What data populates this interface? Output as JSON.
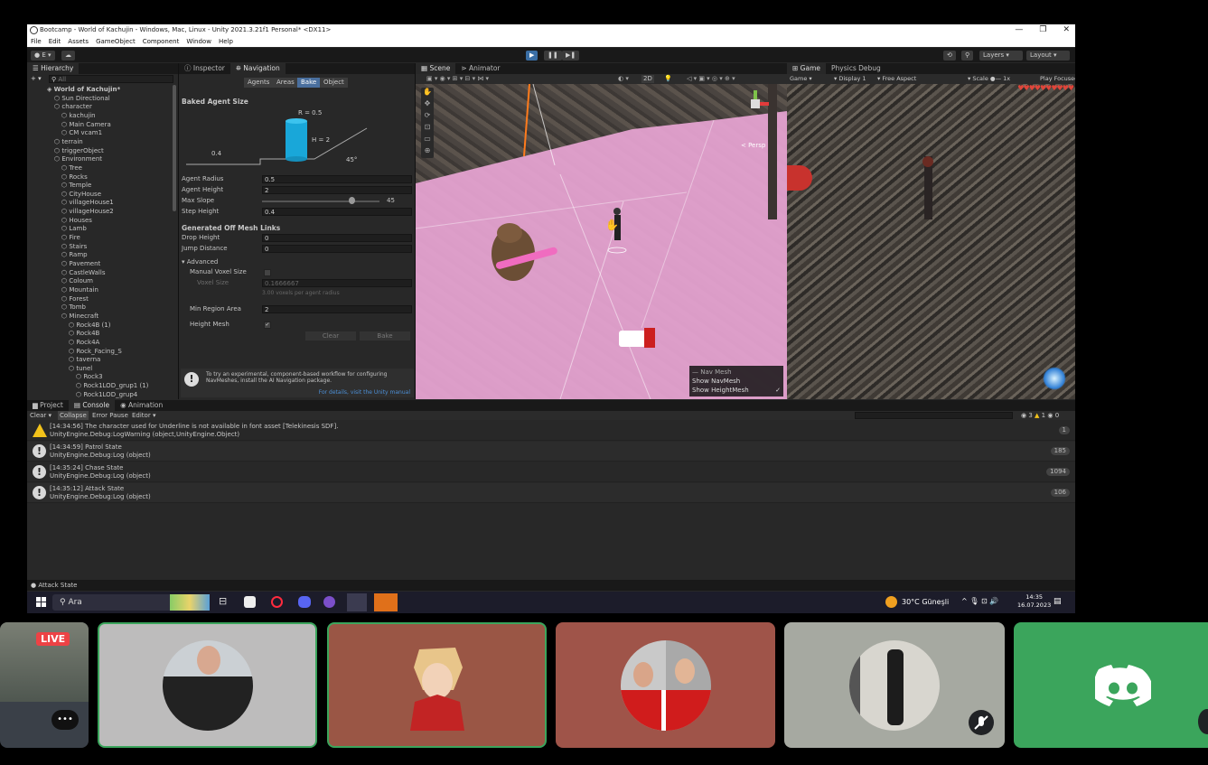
{
  "window": {
    "title": "Bootcamp - World of Kachujin - Windows, Mac, Linux - Unity 2021.3.21f1 Personal* <DX11>",
    "controls": [
      "—",
      "❐",
      "✕"
    ]
  },
  "menu": [
    "File",
    "Edit",
    "Assets",
    "GameObject",
    "Component",
    "Window",
    "Help"
  ],
  "toolbar": {
    "account": "E",
    "layers_label": "Layers",
    "layout_label": "Layout"
  },
  "hierarchy": {
    "tab": "Hierarchy",
    "search_placeholder": "All",
    "items": [
      {
        "label": "World of Kachujin*",
        "depth": 0
      },
      {
        "label": "Sun Directional",
        "depth": 1
      },
      {
        "label": "character",
        "depth": 1
      },
      {
        "label": "kachujin",
        "depth": 2
      },
      {
        "label": "Main Camera",
        "depth": 2
      },
      {
        "label": "CM vcam1",
        "depth": 2
      },
      {
        "label": "terrain",
        "depth": 1
      },
      {
        "label": "triggerObject",
        "depth": 1
      },
      {
        "label": "Environment",
        "depth": 1
      },
      {
        "label": "Tree",
        "depth": 2
      },
      {
        "label": "Rocks",
        "depth": 2
      },
      {
        "label": "Temple",
        "depth": 2
      },
      {
        "label": "CityHouse",
        "depth": 2
      },
      {
        "label": "villageHouse1",
        "depth": 2
      },
      {
        "label": "villageHouse2",
        "depth": 2
      },
      {
        "label": "Houses",
        "depth": 2
      },
      {
        "label": "Lamb",
        "depth": 2
      },
      {
        "label": "Fire",
        "depth": 2
      },
      {
        "label": "Stairs",
        "depth": 2
      },
      {
        "label": "Ramp",
        "depth": 2
      },
      {
        "label": "Pavement",
        "depth": 2
      },
      {
        "label": "CastleWalls",
        "depth": 2
      },
      {
        "label": "Coloum",
        "depth": 2
      },
      {
        "label": "Mountain",
        "depth": 2
      },
      {
        "label": "Forest",
        "depth": 2
      },
      {
        "label": "Tomb",
        "depth": 2
      },
      {
        "label": "Minecraft",
        "depth": 2
      },
      {
        "label": "Rock4B (1)",
        "depth": 3
      },
      {
        "label": "Rock4B",
        "depth": 3
      },
      {
        "label": "Rock4A",
        "depth": 3
      },
      {
        "label": "Rock_Facing_S",
        "depth": 3
      },
      {
        "label": "taverna",
        "depth": 3
      },
      {
        "label": "tunel",
        "depth": 3
      },
      {
        "label": "Rock3",
        "depth": 4
      },
      {
        "label": "Rock1LOD_grup1 (1)",
        "depth": 4
      },
      {
        "label": "Rock1LOD_grup4",
        "depth": 4
      }
    ]
  },
  "inspector": {
    "tabs": [
      "Inspector",
      "Navigation"
    ],
    "subtabs": [
      "Agents",
      "Areas",
      "Bake",
      "Object"
    ],
    "baked_agent_size": "Baked Agent Size",
    "diagram": {
      "r": "R = 0.5",
      "h": "H = 2",
      "step": "0.4",
      "slope": "45°"
    },
    "fields": [
      {
        "label": "Agent Radius",
        "value": "0.5"
      },
      {
        "label": "Agent Height",
        "value": "2"
      },
      {
        "label": "Max Slope",
        "value": "45"
      },
      {
        "label": "Step Height",
        "value": "0.4"
      }
    ],
    "offmesh_title": "Generated Off Mesh Links",
    "offmesh_fields": [
      {
        "label": "Drop Height",
        "value": "0"
      },
      {
        "label": "Jump Distance",
        "value": "0"
      }
    ],
    "advanced": "Advanced",
    "manual_voxel": "Manual Voxel Size",
    "voxel_size": "Voxel Size",
    "voxel_value": "0.1666667",
    "voxel_hint": "3.00 voxels per agent radius",
    "min_region": "Min Region Area",
    "min_region_value": "2",
    "height_mesh": "Height Mesh",
    "clear_btn": "Clear",
    "bake_btn": "Bake",
    "info_text_1": "To try an experimental, component-based workflow for configuring",
    "info_text_2": "NavMeshes, install the AI Navigation package.",
    "info_link": "For details, visit the Unity manual"
  },
  "scene": {
    "tabs": [
      "Scene",
      "Animator"
    ],
    "mode_2d": "2D",
    "persp": "< Persp",
    "nav_legend_title": "Nav Mesh",
    "nav_show_navmesh": "Show NavMesh",
    "nav_show_heightmesh": "Show HeightMesh"
  },
  "game": {
    "tabs": [
      "Game",
      "Physics Debug"
    ],
    "display": "Game",
    "display_num": "Display 1",
    "aspect": "Free Aspect",
    "scale": "Scale",
    "scale_value": "1x",
    "play_focus": "Play Focused",
    "hearts": "♥♥♥♥♥♥♥♥♥♥"
  },
  "console": {
    "tabs": [
      "Project",
      "Console",
      "Animation"
    ],
    "toolbar": [
      "Clear",
      "Collapse",
      "Error Pause",
      "Editor"
    ],
    "counts": {
      "info": "3",
      "warn": "1",
      "error": "0"
    },
    "logs": [
      {
        "type": "warn",
        "line1": "[14:34:56] The character used for Underline is not available in font asset [Telekinesis SDF].",
        "line2": "UnityEngine.Debug:LogWarning (object,UnityEngine.Object)",
        "count": "1"
      },
      {
        "type": "info",
        "line1": "[14:34:59] Patrol State",
        "line2": "UnityEngine.Debug:Log (object)",
        "count": "185"
      },
      {
        "type": "info",
        "line1": "[14:35:24] Chase State",
        "line2": "UnityEngine.Debug:Log (object)",
        "count": "1094"
      },
      {
        "type": "info",
        "line1": "[14:35:12] Attack State",
        "line2": "UnityEngine.Debug:Log (object)",
        "count": "106"
      }
    ]
  },
  "status": "Attack State",
  "taskbar": {
    "search": "Ara",
    "weather": "30°C",
    "weather_desc": "Güneşli",
    "time": "14:35",
    "date": "16.07.2023"
  },
  "call": {
    "live": "LIVE",
    "more": "•••",
    "colors": {
      "tile1": "#bdbcbc",
      "tile2": "#9a5645",
      "tile3": "#9f5449",
      "tile4": "#a6a9a1",
      "tile5": "#3ba55c"
    }
  }
}
